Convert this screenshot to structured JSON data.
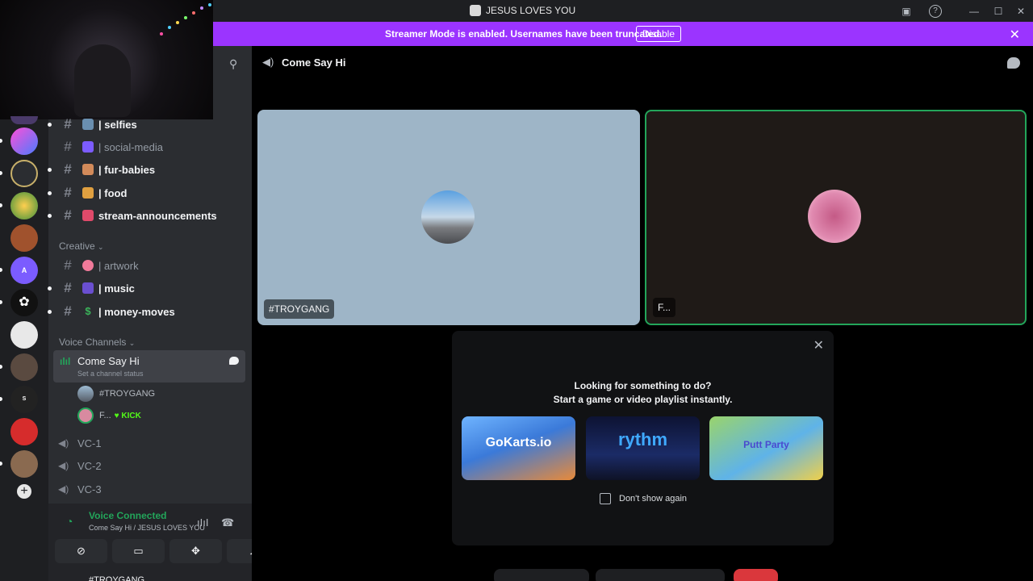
{
  "titlebar": {
    "title": "JESUS LOVES YOU"
  },
  "banner": {
    "message": "Streamer Mode is enabled. Usernames have been truncated.",
    "disable_label": "Disable"
  },
  "sidebar": {
    "channels": [
      {
        "name": "| selfies",
        "state": "unread"
      },
      {
        "name": "| social-media",
        "state": "read"
      },
      {
        "name": "| fur-babies",
        "state": "unread"
      },
      {
        "name": "| food",
        "state": "unread"
      },
      {
        "name": "stream-announcements",
        "state": "unread"
      }
    ],
    "category_creative": "Creative",
    "creative_channels": [
      {
        "name": "| artwork",
        "state": "read"
      },
      {
        "name": "| music",
        "state": "unread"
      },
      {
        "name": "| money-moves",
        "state": "unread"
      }
    ],
    "category_voice": "Voice Channels",
    "active_voice": {
      "name": "Come Say Hi",
      "status": "Set a channel status"
    },
    "members": [
      {
        "name": "#TROYGANG",
        "badge": ""
      },
      {
        "name": "F...",
        "badge": "KICK"
      }
    ],
    "voice_channels": [
      "VC-1",
      "VC-2",
      "VC-3"
    ]
  },
  "voice_panel": {
    "status": "Voice Connected",
    "location": "Come Say Hi / JESUS LOVES YOU"
  },
  "bottom_user": "#TROYGANG",
  "call": {
    "channel_name": "Come Say Hi",
    "tiles": [
      {
        "label": "#TROYGANG"
      },
      {
        "label": "F..."
      }
    ]
  },
  "activity_modal": {
    "line1": "Looking for something to do?",
    "line2": "Start a game or video playlist instantly.",
    "games": [
      "GoKarts.io",
      "rythm",
      "Putt Party"
    ],
    "checkbox_label": "Don't show again"
  },
  "colors": {
    "banner": "#9b34ff",
    "connected": "#23a55a",
    "kick": "#53fc18",
    "leave": "#da373c"
  }
}
